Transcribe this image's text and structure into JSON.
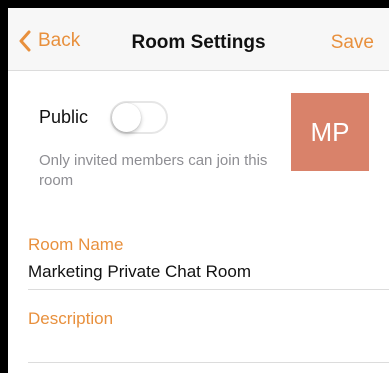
{
  "navbar": {
    "back_label": "Back",
    "title": "Room Settings",
    "save_label": "Save"
  },
  "public_setting": {
    "label": "Public",
    "enabled": false,
    "hint": "Only invited members can join this room"
  },
  "avatar": {
    "initials": "MP",
    "color": "#d9826a"
  },
  "room_name": {
    "label": "Room Name",
    "value": "Marketing Private Chat Room"
  },
  "description": {
    "label": "Description",
    "value": ""
  },
  "colors": {
    "accent": "#e8903d",
    "hint_text": "#8e8e93"
  }
}
